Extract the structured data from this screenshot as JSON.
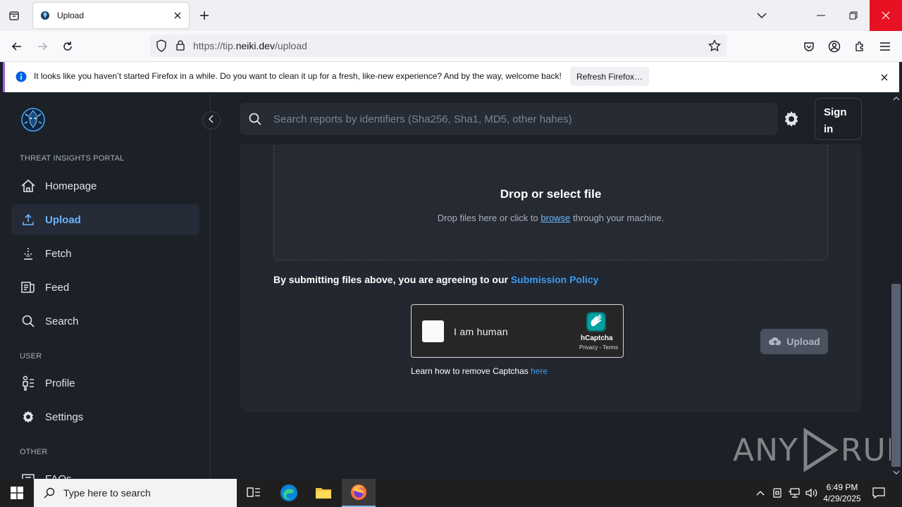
{
  "browser": {
    "tab_title": "Upload",
    "url_prefix": "https://tip.",
    "url_domain": "neiki.dev",
    "url_path": "/upload",
    "notification": "It looks like you haven’t started Firefox in a while. Do you want to clean it up for a fresh, like-new experience? And by the way, welcome back!",
    "refresh_button": "Refresh Firefox…"
  },
  "sidebar": {
    "section_portal": "THREAT INSIGHTS PORTAL",
    "section_user": "USER",
    "section_other": "OTHER",
    "items": [
      {
        "label": "Homepage",
        "icon": "home-icon"
      },
      {
        "label": "Upload",
        "icon": "upload-icon",
        "active": true
      },
      {
        "label": "Fetch",
        "icon": "fetch-icon"
      },
      {
        "label": "Feed",
        "icon": "feed-icon"
      },
      {
        "label": "Search",
        "icon": "search-icon"
      },
      {
        "label": "Profile",
        "icon": "profile-icon"
      },
      {
        "label": "Settings",
        "icon": "gear-icon"
      },
      {
        "label": "FAQs",
        "icon": "faq-icon"
      }
    ]
  },
  "header": {
    "search_placeholder": "Search reports by identifiers (Sha256, Sha1, MD5, other hahes)",
    "sign_in": "Sign in"
  },
  "upload": {
    "drop_title": "Drop or select file",
    "drop_sub_pre": "Drop files here or click to",
    "drop_sub_link": "browse",
    "drop_sub_post": "through your machine.",
    "policy_text": "By submitting files above, you are agreeing to our",
    "policy_link": "Submission Policy",
    "captcha_label": "I am human",
    "captcha_brand": "hCaptcha",
    "captcha_terms": "Privacy - Terms",
    "learn_text": "Learn how to remove Captchas",
    "learn_link": "here",
    "upload_button": "Upload"
  },
  "watermark": {
    "left": "ANY",
    "right": "RUN"
  },
  "taskbar": {
    "search_placeholder": "Type here to search",
    "time": "6:49 PM",
    "date": "4/29/2025"
  },
  "colors": {
    "accent": "#6cb6ff",
    "link": "#3d9bf0",
    "background": "#1c2027"
  }
}
